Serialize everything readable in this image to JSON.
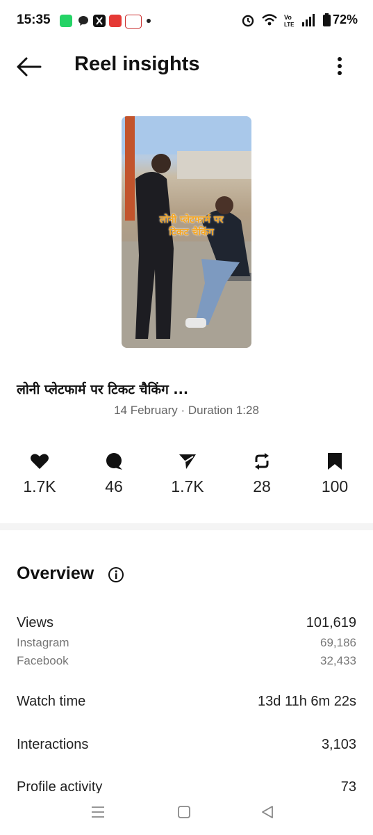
{
  "status_bar": {
    "time": "15:35",
    "notification_icons": [
      "whatsapp-icon",
      "chat-icon",
      "x-icon",
      "calendar-icon",
      "news-icon",
      "dot-icon"
    ],
    "battery": "72%",
    "indicators": [
      "alarm-icon",
      "wifi-icon",
      "volte-icon",
      "signal-icon",
      "battery-icon"
    ]
  },
  "header": {
    "title": "Reel insights"
  },
  "reel": {
    "thumbnail_caption_line1": "लोनी प्लेटफार्म पर",
    "thumbnail_caption_line2": "टिकट चैकिंग",
    "title": "लोनी प्लेटफार्म पर टिकट चैकिंग ...",
    "meta": "14 February · Duration 1:28"
  },
  "stats": [
    {
      "icon": "heart-icon",
      "value": "1.7K"
    },
    {
      "icon": "comment-icon",
      "value": "46"
    },
    {
      "icon": "share-icon",
      "value": "1.7K"
    },
    {
      "icon": "repost-icon",
      "value": "28"
    },
    {
      "icon": "bookmark-icon",
      "value": "100"
    }
  ],
  "overview": {
    "title": "Overview",
    "views_label": "Views",
    "views_value": "101,619",
    "instagram_label": "Instagram",
    "instagram_value": "69,186",
    "facebook_label": "Facebook",
    "facebook_value": "32,433",
    "watch_time_label": "Watch time",
    "watch_time_value": "13d 11h 6m 22s",
    "interactions_label": "Interactions",
    "interactions_value": "3,103",
    "profile_activity_label": "Profile activity",
    "profile_activity_value": "73"
  },
  "colors": {
    "caption": "#f5a623",
    "whatsapp": "#25d366",
    "calendar": "#e53935"
  }
}
